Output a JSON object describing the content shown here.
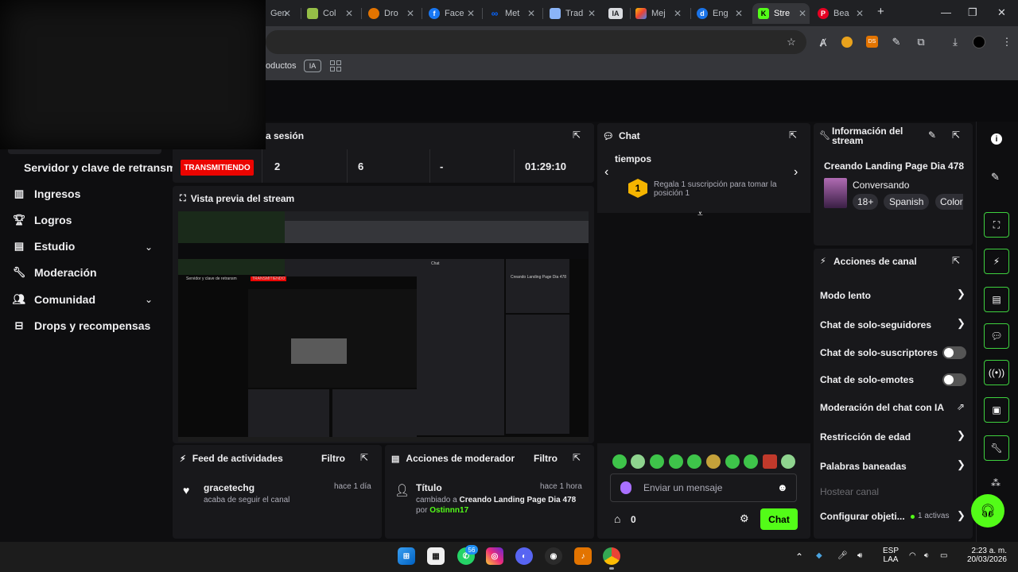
{
  "browser": {
    "tabs": [
      {
        "label": "Gen",
        "favicon": "tab-gen-icon",
        "color": "#8ab4f8"
      },
      {
        "label": "Col",
        "favicon": "shopify-icon",
        "color": "#95bf47"
      },
      {
        "label": "Dro",
        "favicon": "dropship-icon",
        "color": "#e37400"
      },
      {
        "label": "Face",
        "favicon": "facebook-icon",
        "color": "#1877f2"
      },
      {
        "label": "Met",
        "favicon": "meta-icon",
        "color": "#0866ff"
      },
      {
        "label": "Trad",
        "favicon": "translate-icon",
        "color": "#8ab4f8"
      },
      {
        "label": "IA",
        "favicon": "ia-icon",
        "color": "#dadce0"
      },
      {
        "label": "Mej",
        "favicon": "mej-icon",
        "color": "#fbbc04"
      },
      {
        "label": "Eng",
        "favicon": "eng-icon",
        "color": "#1a73e8"
      },
      {
        "label": "Stre",
        "favicon": "kick-icon",
        "color": "#53fc18"
      },
      {
        "label": "Bea",
        "favicon": "pinterest-icon",
        "color": "#e60023"
      }
    ],
    "bookmarks": {
      "productos": "oductos",
      "ia": "IA"
    }
  },
  "sidebar": {
    "title": "Servidor y clave de retransm",
    "items": [
      {
        "label": "Ingresos",
        "icon": "chart-icon"
      },
      {
        "label": "Logros",
        "icon": "trophy-icon"
      },
      {
        "label": "Estudio",
        "icon": "studio-icon",
        "expandable": true
      },
      {
        "label": "Moderación",
        "icon": "wrench-icon"
      },
      {
        "label": "Comunidad",
        "icon": "users-icon",
        "expandable": true
      },
      {
        "label": "Drops y recompensas",
        "icon": "drops-icon"
      }
    ]
  },
  "session": {
    "title": "a sesión",
    "status": "TRANSMITIENDO",
    "stats": [
      "2",
      "6",
      "-",
      "01:29:10"
    ]
  },
  "preview": {
    "title": "Vista previa del stream"
  },
  "activity": {
    "title": "Feed de actividades",
    "filter": "Filtro",
    "item": {
      "user": "gracetechg",
      "text": "acaba de seguir el canal",
      "time": "hace 1 día"
    }
  },
  "modactions": {
    "title": "Acciones de moderador",
    "filter": "Filtro",
    "item": {
      "title": "Título",
      "time": "hace 1 hora",
      "line1_prefix": "cambiado a",
      "line1_value": "Creando Landing Page Dia 478",
      "line2_prefix": "por",
      "line2_value": "Ostinnn17"
    }
  },
  "chat": {
    "title": "Chat",
    "partial": "tiempos",
    "promo": "Regala 1 suscripción para tomar la posición 1",
    "rank": "1",
    "placeholder": "Enviar un mensaje",
    "points": "0",
    "send": "Chat"
  },
  "streaminfo": {
    "title": "Información del stream",
    "stream_title": "Creando Landing Page Dia 478",
    "category": "Conversando",
    "tags": [
      "18+",
      "Spanish",
      "Color"
    ]
  },
  "channel": {
    "title": "Acciones de canal",
    "rows": [
      {
        "label": "Modo lento",
        "control": "chevron"
      },
      {
        "label": "Chat de solo-seguidores",
        "control": "chevron"
      },
      {
        "label": "Chat de solo-suscriptores",
        "control": "toggle"
      },
      {
        "label": "Chat de solo-emotes",
        "control": "toggle"
      },
      {
        "label": "Moderación del chat con IA",
        "control": "external"
      },
      {
        "label": "Restricción de edad",
        "control": "chevron"
      },
      {
        "label": "Palabras baneadas",
        "control": "chevron"
      },
      {
        "label": "Hostear canal",
        "control": "none"
      },
      {
        "label": "Configurar objeti...",
        "control": "chevron"
      }
    ],
    "goals_active": "1 activas"
  },
  "taskbar": {
    "whatsapp_badge": "56",
    "lang": "ESP",
    "lang2": "LAA",
    "time": "2:23 a. m.",
    "date": "20/03/2026"
  },
  "colors": {
    "accent": "#53fc18",
    "live": "#eb0400",
    "panel": "#18181b"
  }
}
